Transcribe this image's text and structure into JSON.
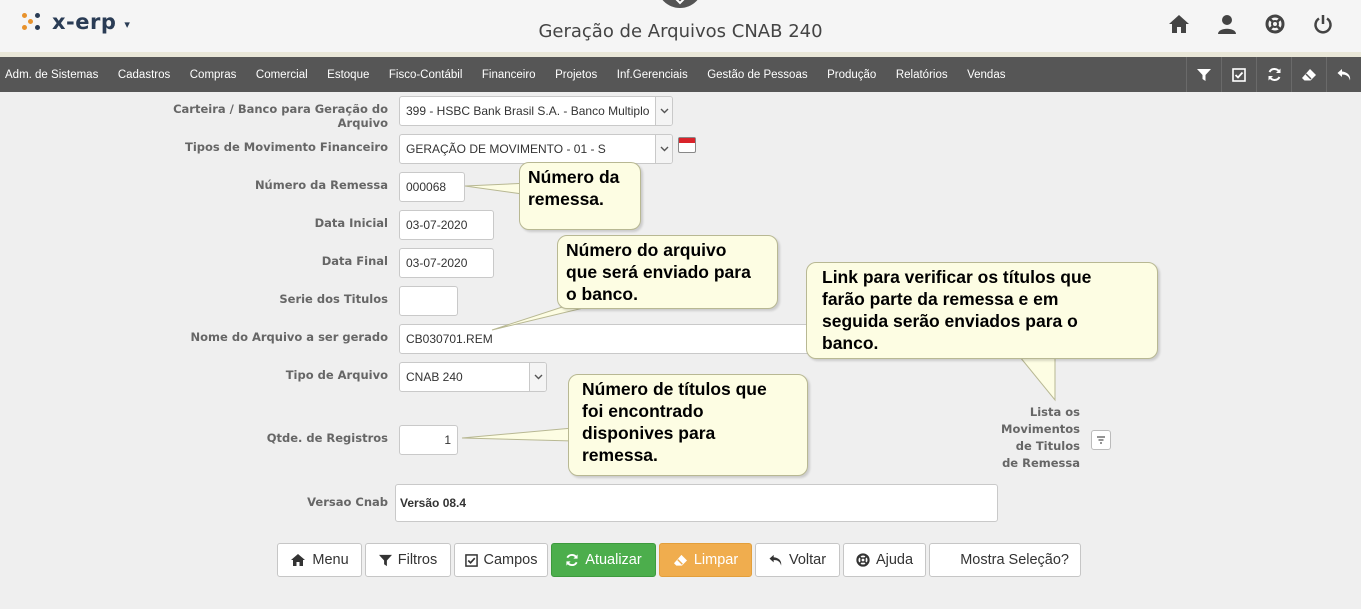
{
  "app": {
    "logo_text": "x-erp",
    "page_title": "Geração de Arquivos CNAB 240"
  },
  "top_icons": [
    "home-icon",
    "user-icon",
    "lifebuoy-icon",
    "power-icon"
  ],
  "menu": {
    "items": [
      "Adm. de Sistemas",
      "Cadastros",
      "Compras",
      "Comercial",
      "Estoque",
      "Fisco-Contábil",
      "Financeiro",
      "Projetos",
      "Inf.Gerenciais",
      "Gestão de Pessoas",
      "Produção",
      "Relatórios",
      "Vendas"
    ],
    "icons": [
      "filter-icon",
      "checkbox-icon",
      "refresh-icon",
      "eraser-icon",
      "undo-icon"
    ]
  },
  "form": {
    "carteira": {
      "label": "Carteira / Banco para Geração do Arquivo",
      "value": "399 - HSBC Bank Brasil S.A. - Banco Multiplo"
    },
    "tipos_mov": {
      "label": "Tipos de Movimento Financeiro",
      "value": "GERAÇÃO DE MOVIMENTO - 01 - S"
    },
    "numero_remessa": {
      "label": "Número da Remessa",
      "value": "000068"
    },
    "data_inicial": {
      "label": "Data Inicial",
      "value": "03-07-2020"
    },
    "data_final": {
      "label": "Data Final",
      "value": "03-07-2020"
    },
    "serie": {
      "label": "Serie dos Titulos",
      "value": ""
    },
    "nome_arquivo": {
      "label": "Nome do Arquivo a ser gerado",
      "value": "CB030701.REM"
    },
    "tipo_arquivo": {
      "label": "Tipo de Arquivo",
      "value": "CNAB 240"
    },
    "qtde_registros": {
      "label": "Qtde. de Registros",
      "value": "1"
    },
    "versao_cnab": {
      "label": "Versao Cnab",
      "value": "Versão 08.4"
    }
  },
  "link": {
    "line1": "Lista os",
    "line2": "Movimentos",
    "line3": "de Titulos",
    "line4": "de Remessa"
  },
  "callouts": {
    "remessa": {
      "line1": "Número da",
      "line2": "remessa."
    },
    "arquivo": {
      "line1": "Número do arquivo",
      "line2": "que será enviado para",
      "line3": "o banco."
    },
    "link": {
      "line1": "Link para verificar os títulos que",
      "line2": "farão parte da remessa e em",
      "line3": "seguida serão enviados para o",
      "line4": "banco."
    },
    "titulos": {
      "line1": "Número de títulos que",
      "line2": "foi encontrado",
      "line3": "disponives para",
      "line4": "remessa."
    }
  },
  "buttons": {
    "menu": "Menu",
    "filtros": "Filtros",
    "campos": "Campos",
    "atualizar": "Atualizar",
    "limpar": "Limpar",
    "voltar": "Voltar",
    "ajuda": "Ajuda",
    "mostra": "Mostra Seleção?"
  },
  "colors": {
    "menubar": "#565656",
    "green": "#4cae4c",
    "orange": "#f0ad4e",
    "callout_bg": "#fdfde3"
  }
}
